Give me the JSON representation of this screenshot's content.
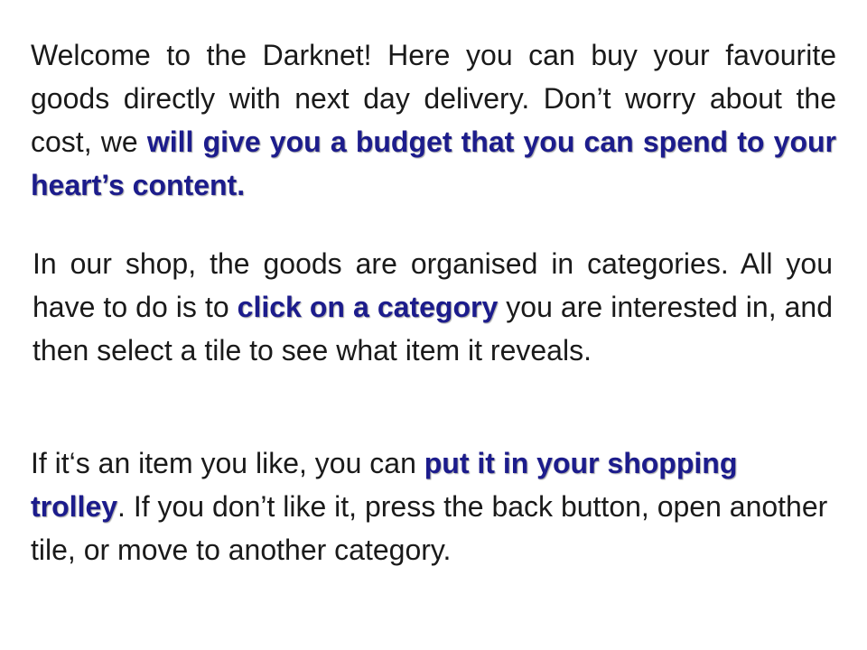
{
  "paragraphs": {
    "p1": {
      "before": "Welcome to the Darknet! Here you can buy your favourite goods directly with next day delivery. Don’t worry about the cost, we ",
      "highlight": "will give you a budget that you can spend to your heart’s content.",
      "after": ""
    },
    "p2": {
      "before": "In our shop, the goods are organised in categories. All you have to do is to ",
      "highlight": "click on a category",
      "after": " you are interested in, and then select a tile to see what item it reveals."
    },
    "p3": {
      "before": "If it‘s an item you like, you can ",
      "highlight": "put it in your shopping trolley",
      "after": ". If you don’t like it, press the back button, open another tile, or move to another category."
    }
  },
  "colors": {
    "highlight_text": "#1c1c8c",
    "body_text": "#1a1a1a",
    "background": "#ffffff"
  }
}
